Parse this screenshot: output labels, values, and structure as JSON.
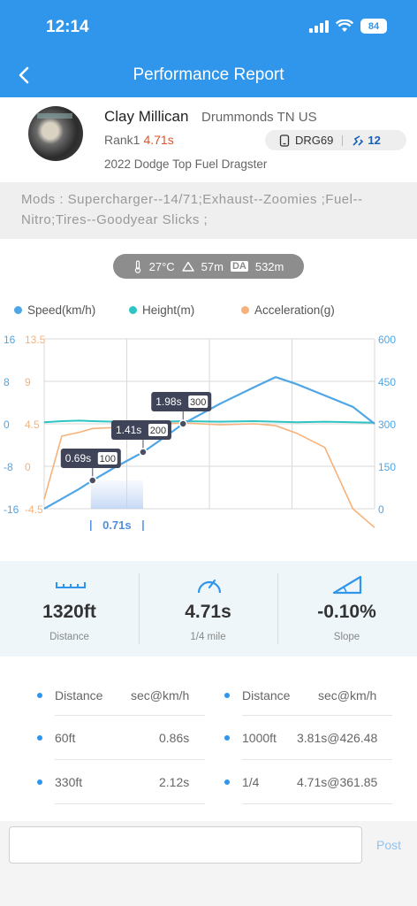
{
  "status": {
    "time": "12:14",
    "battery": "84"
  },
  "nav": {
    "title": "Performance Report"
  },
  "profile": {
    "name": "Clay Millican",
    "location": "Drummonds TN US",
    "rank_label": "Rank1",
    "rank_time": "4.71s",
    "car_id": "DRG69",
    "car_count": "12",
    "car_model": "2022 Dodge Top Fuel Dragster"
  },
  "mods": {
    "text": "Mods : Supercharger--14/71;Exhaust--Zoomies ;Fuel--Nitro;Tires--Goodyear Slicks ;"
  },
  "conditions": {
    "temp": "27°C",
    "altitude": "57m",
    "da_label": "DA",
    "da_value": "532m"
  },
  "legend": {
    "speed": "Speed(km/h)",
    "height": "Height(m)",
    "accel": "Acceleration(g)"
  },
  "colors": {
    "brand": "#2f96ec",
    "speed": "#4fa6e6",
    "height": "#2ec4c4",
    "accel": "#f6b27a"
  },
  "chart_data": {
    "type": "line",
    "x": [
      0,
      0.25,
      0.5,
      0.69,
      1.0,
      1.41,
      1.7,
      1.98,
      2.5,
      3.0,
      3.3,
      3.6,
      4.0,
      4.4,
      4.71
    ],
    "series": [
      {
        "name": "Speed(km/h)",
        "values": [
          0,
          35,
          70,
          100,
          145,
          200,
          250,
          300,
          370,
          430,
          465,
          440,
          400,
          360,
          300
        ]
      },
      {
        "name": "Height(m)",
        "values": [
          0.3,
          0.5,
          0.6,
          0.5,
          0.4,
          0.3,
          0.4,
          0.5,
          0.4,
          0.5,
          0.4,
          0.3,
          0.4,
          0.3,
          0.2
        ]
      },
      {
        "name": "Acceleration(g)",
        "values": [
          -3.5,
          3.2,
          3.6,
          4.0,
          4.1,
          4.0,
          4.5,
          4.6,
          4.4,
          4.5,
          4.3,
          3.5,
          2.0,
          -4.5,
          -6.5
        ]
      }
    ],
    "y_left_ticks": [
      "16",
      "8",
      "0",
      "-8",
      "-16"
    ],
    "y_accel_ticks": [
      "13.5",
      "9",
      "4.5",
      "0",
      "-4.5"
    ],
    "y_right_ticks": [
      "600",
      "450",
      "300",
      "150",
      "0"
    ],
    "annotations": [
      {
        "time": "0.69s",
        "speed": "100"
      },
      {
        "time": "1.41s",
        "speed": "200"
      },
      {
        "time": "1.98s",
        "speed": "300"
      }
    ],
    "highlight": "0.71s",
    "grid": true
  },
  "stats": [
    {
      "value": "1320ft",
      "label": "Distance"
    },
    {
      "value": "4.71s",
      "label": "1/4 mile"
    },
    {
      "value": "-0.10%",
      "label": "Slope"
    }
  ],
  "splits": {
    "header": {
      "c1": "Distance",
      "c2": "sec@km/h",
      "c3": "Distance",
      "c4": "sec@km/h"
    },
    "rows": [
      {
        "c1": "60ft",
        "c2": "0.86s",
        "c3": "1000ft",
        "c4": "3.81s@426.48"
      },
      {
        "c1": "330ft",
        "c2": "2.12s",
        "c3": "1/4",
        "c4": "4.71s@361.85"
      }
    ]
  },
  "comment": {
    "post_label": "Post"
  }
}
